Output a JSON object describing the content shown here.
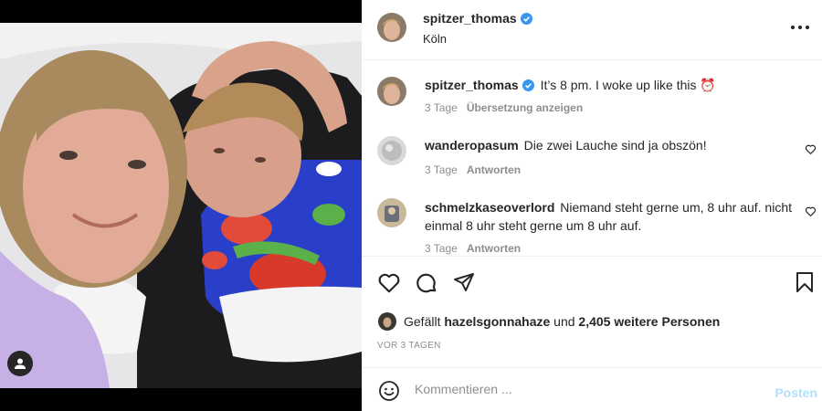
{
  "post": {
    "username": "spitzer_thomas",
    "location": "Köln",
    "verified_icon": "verified-badge-icon",
    "more_icon": "more-options-icon"
  },
  "caption": {
    "username": "spitzer_thomas",
    "text": "It’s 8 pm. I woke up like this ⏰",
    "time": "3 Tage",
    "translate_label": "Übersetzung anzeigen"
  },
  "comments": [
    {
      "username": "wanderopasum",
      "text": "Die zwei Lauche sind ja obszön!",
      "time": "3 Tage",
      "reply_label": "Antworten"
    },
    {
      "username": "schmelzkaseoverlord",
      "text": "Niemand steht gerne um, 8 uhr auf. nicht einmal 8 uhr steht gerne um 8 uhr auf.",
      "time": "3 Tage",
      "reply_label": "Antworten"
    }
  ],
  "actions": {
    "icons": [
      "heart-icon",
      "comment-icon",
      "share-icon",
      "bookmark-icon"
    ],
    "likes_prefix": "Gefällt",
    "likes_user": "hazelsgonnahaze",
    "likes_and": "und",
    "likes_count": "2,405 weitere Personen",
    "date": "VOR 3 TAGEN"
  },
  "composer": {
    "placeholder": "Kommentieren ...",
    "post_label": "Posten",
    "emoji_icon": "emoji-icon"
  },
  "colors": {
    "verified": "#3897f0",
    "post_disabled": "#b2dffc",
    "muted": "#8e8e8e"
  }
}
